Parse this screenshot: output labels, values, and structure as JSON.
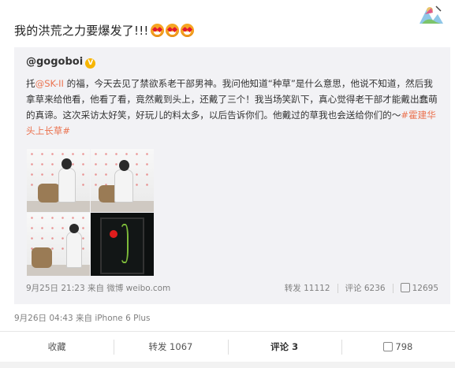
{
  "post": {
    "text": "我的洪荒之力要爆发了!!!",
    "emojis": [
      "heart-eyes-icon",
      "heart-eyes-icon",
      "heart-eyes-icon"
    ],
    "meta": "9月26日 04:43 来自 iPhone 6 Plus"
  },
  "repost": {
    "author": "@gogoboi",
    "badge": "V",
    "body_before_mention": "托",
    "mention": "@SK-II",
    "body_after_mention": " 的福，今天去见了禁欲系老干部男神。我问他知道“种草”是什么意思，他说不知道，然后我拿草来给他看，他看了看，竟然戴到头上，还戴了三个！我当场笑趴下，真心觉得老干部才能戴出蠢萌的真谛。这次采访太好笑，好玩儿的料太多，以后告诉你们。他戴过的草我也会送给你们的～",
    "hashtag": "#霍建华头上长草#",
    "meta": "9月25日 21:23 来自 微博 weibo.com",
    "repost_label": "转发 11112",
    "comment_label": "评论 6236",
    "like_count": "12695"
  },
  "actions": {
    "favorite": "收藏",
    "repost": "转发 1067",
    "comment_label": "评论",
    "comment_count": "3",
    "like": "798"
  },
  "colors": {
    "link": "#eb7350",
    "badge": "#f7b500",
    "repost_bg": "#f2f2f5"
  }
}
